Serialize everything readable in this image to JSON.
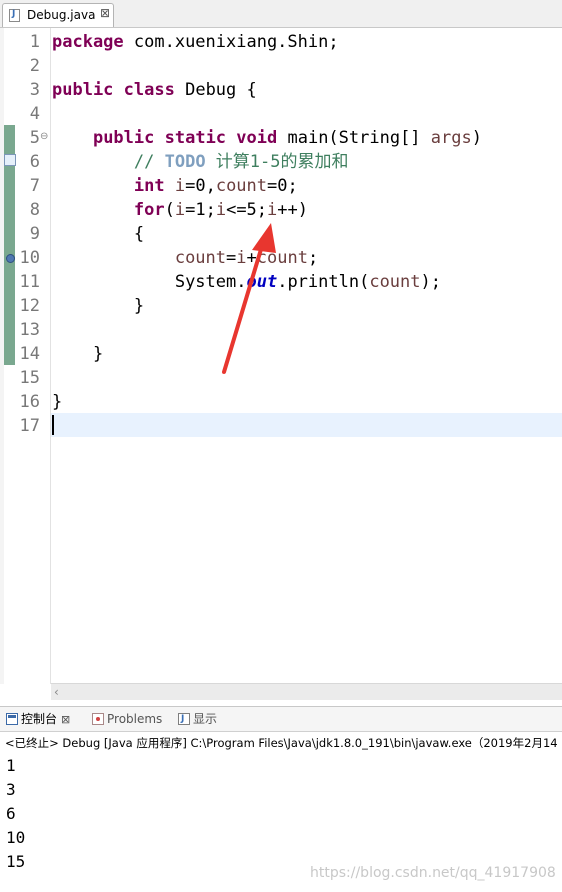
{
  "editor_tab": {
    "label": "Debug.java",
    "close": "⊠"
  },
  "editor": {
    "line_numbers": [
      "1",
      "2",
      "3",
      "4",
      "5",
      "6",
      "7",
      "8",
      "9",
      "10",
      "11",
      "12",
      "13",
      "14",
      "15",
      "16",
      "17"
    ],
    "fold_marker": "⊖",
    "lines": {
      "l1": {
        "kw": "package",
        "rest": " com.xuenixiang.Shin;"
      },
      "l3": {
        "kw1": "public",
        "sp": " ",
        "kw2": "class",
        "rest": " Debug {"
      },
      "l5": {
        "kw1": "public",
        "kw2": "static",
        "kw3": "void",
        "name": " main(String[] ",
        "arg": "args",
        "end": ")"
      },
      "l6": {
        "comment": "// ",
        "todo": "TODO",
        "text": " 计算1-5的累加和"
      },
      "l7": {
        "kw": "int",
        "v1": "i",
        "mid": "=0,",
        "v2": "count",
        "end": "=0;"
      },
      "l8": {
        "kw": "for",
        "a": "(",
        "v1": "i",
        "b": "=1;",
        "v2": "i",
        "c": "<=5;",
        "v3": "i",
        "d": "++)"
      },
      "l9": "{",
      "l10": {
        "v1": "count",
        "a": "=",
        "v2": "i",
        "b": "+",
        "v3": "count",
        "c": ";"
      },
      "l11": {
        "a": "System.",
        "field": "out",
        "b": ".println(",
        "v": "count",
        "c": ");"
      },
      "l12": "}",
      "l14": "}",
      "l16": "}"
    }
  },
  "views": {
    "console_tab": "控制台",
    "console_close": "⊠",
    "problems_tab": "Problems",
    "display_tab": "显示"
  },
  "console": {
    "header": "<已终止> Debug [Java 应用程序] C:\\Program Files\\Java\\jdk1.8.0_191\\bin\\javaw.exe（2019年2月14",
    "output": [
      "1",
      "3",
      "6",
      "10",
      "15"
    ]
  },
  "watermark": "https://blog.csdn.net/qq_41917908",
  "colors": {
    "keyword": "#7f0055",
    "variable": "#6a3e3e",
    "comment": "#3f7f5f",
    "arrow": "#e8362f"
  }
}
